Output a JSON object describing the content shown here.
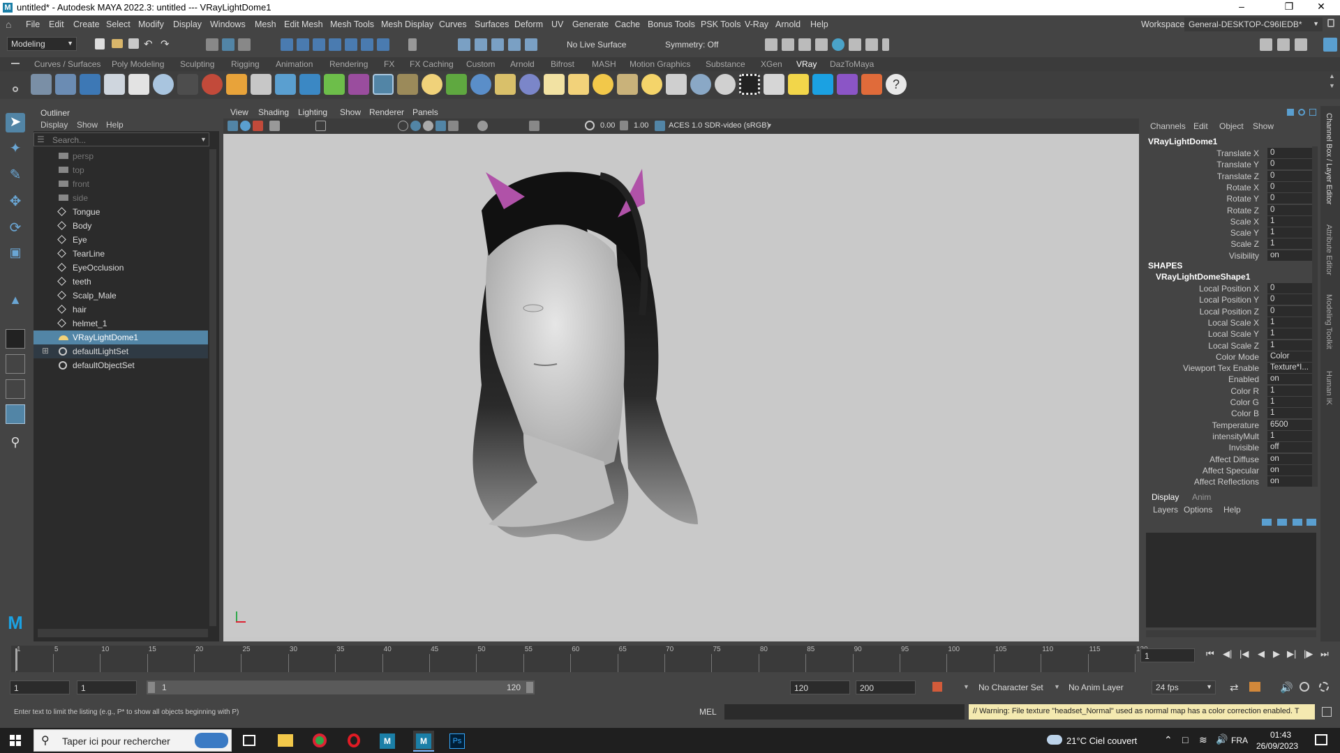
{
  "window": {
    "title": "untitled* - Autodesk MAYA 2022.3: untitled  ---  VRayLightDome1"
  },
  "menubar": {
    "items": [
      "File",
      "Edit",
      "Create",
      "Select",
      "Modify",
      "Display",
      "Windows",
      "Mesh",
      "Edit Mesh",
      "Mesh Tools",
      "Mesh Display",
      "Curves",
      "Surfaces",
      "Deform",
      "UV",
      "Generate",
      "Cache",
      "Bonus Tools",
      "PSK Tools",
      "V-Ray",
      "Arnold",
      "Help"
    ],
    "workspace_label": "Workspace:",
    "workspace_value": "General-DESKTOP-C96IEDB*"
  },
  "statusline": {
    "mode": "Modeling",
    "live_surface": "No Live Surface",
    "symmetry": "Symmetry: Off"
  },
  "shelf": {
    "tabs": [
      "Curves / Surfaces",
      "Poly Modeling",
      "Sculpting",
      "Rigging",
      "Animation",
      "Rendering",
      "FX",
      "FX Caching",
      "Custom",
      "Arnold",
      "Bifrost",
      "MASH",
      "Motion Graphics",
      "Substance",
      "XGen",
      "VRay",
      "DazToMaya"
    ],
    "active_tab": "VRay"
  },
  "outliner": {
    "title": "Outliner",
    "menu": [
      "Display",
      "Show",
      "Help"
    ],
    "search_placeholder": "Search...",
    "items": [
      {
        "label": "persp",
        "type": "camera",
        "dim": true
      },
      {
        "label": "top",
        "type": "camera",
        "dim": true
      },
      {
        "label": "front",
        "type": "camera",
        "dim": true
      },
      {
        "label": "side",
        "type": "camera",
        "dim": true
      },
      {
        "label": "Tongue",
        "type": "mesh"
      },
      {
        "label": "Body",
        "type": "mesh"
      },
      {
        "label": "Eye",
        "type": "mesh"
      },
      {
        "label": "TearLine",
        "type": "mesh"
      },
      {
        "label": "EyeOcclusion",
        "type": "mesh"
      },
      {
        "label": "teeth",
        "type": "mesh"
      },
      {
        "label": "Scalp_Male",
        "type": "mesh"
      },
      {
        "label": "hair",
        "type": "mesh"
      },
      {
        "label": "helmet_1",
        "type": "mesh"
      },
      {
        "label": "VRayLightDome1",
        "type": "light",
        "selected": true
      },
      {
        "label": "defaultLightSet",
        "type": "set",
        "expandable": true
      },
      {
        "label": "defaultObjectSet",
        "type": "set"
      }
    ]
  },
  "viewport": {
    "menu": [
      "View",
      "Shading",
      "Lighting",
      "Show",
      "Renderer",
      "Panels"
    ],
    "exposure": "0.00",
    "gamma": "1.00",
    "color_space": "ACES 1.0 SDR-video (sRGB)"
  },
  "channelbox": {
    "menu": [
      "Channels",
      "Edit",
      "Object",
      "Show"
    ],
    "object_name": "VRayLightDome1",
    "transform": [
      {
        "name": "Translate X",
        "value": "0"
      },
      {
        "name": "Translate Y",
        "value": "0"
      },
      {
        "name": "Translate Z",
        "value": "0"
      },
      {
        "name": "Rotate X",
        "value": "0"
      },
      {
        "name": "Rotate Y",
        "value": "0"
      },
      {
        "name": "Rotate Z",
        "value": "0"
      },
      {
        "name": "Scale X",
        "value": "1"
      },
      {
        "name": "Scale Y",
        "value": "1"
      },
      {
        "name": "Scale Z",
        "value": "1"
      },
      {
        "name": "Visibility",
        "value": "on"
      }
    ],
    "shapes_label": "SHAPES",
    "shape_name": "VRayLightDomeShape1",
    "shape_attrs": [
      {
        "name": "Local Position X",
        "value": "0"
      },
      {
        "name": "Local Position Y",
        "value": "0"
      },
      {
        "name": "Local Position Z",
        "value": "0"
      },
      {
        "name": "Local Scale X",
        "value": "1"
      },
      {
        "name": "Local Scale Y",
        "value": "1"
      },
      {
        "name": "Local Scale Z",
        "value": "1"
      },
      {
        "name": "Color Mode",
        "value": "Color"
      },
      {
        "name": "Viewport Tex Enable",
        "value": "Texture*I..."
      },
      {
        "name": "Enabled",
        "value": "on"
      },
      {
        "name": "Color R",
        "value": "1"
      },
      {
        "name": "Color G",
        "value": "1"
      },
      {
        "name": "Color B",
        "value": "1"
      },
      {
        "name": "Temperature",
        "value": "6500"
      },
      {
        "name": "intensityMult",
        "value": "1"
      },
      {
        "name": "Invisible",
        "value": "off"
      },
      {
        "name": "Affect Diffuse",
        "value": "on"
      },
      {
        "name": "Affect Specular",
        "value": "on"
      },
      {
        "name": "Affect Reflections",
        "value": "on"
      }
    ]
  },
  "side_tabs": [
    "Channel Box / Layer Editor",
    "Attribute Editor",
    "Modeling Toolkit",
    "Human IK"
  ],
  "layers": {
    "tabs": [
      "Display",
      "Anim"
    ],
    "menu": [
      "Layers",
      "Options",
      "Help"
    ]
  },
  "timeline": {
    "ticks": [
      "1",
      "5",
      "10",
      "15",
      "20",
      "25",
      "30",
      "35",
      "40",
      "45",
      "50",
      "55",
      "60",
      "65",
      "70",
      "75",
      "80",
      "85",
      "90",
      "95",
      "100",
      "105",
      "110",
      "115",
      "120"
    ],
    "current_frame": "1"
  },
  "range": {
    "start": "1",
    "playback_start": "1",
    "slider_start": "1",
    "slider_end": "120",
    "playback_end": "120",
    "end": "200",
    "character_set": "No Character Set",
    "anim_layer": "No Anim Layer",
    "fps": "24 fps"
  },
  "commandline": {
    "help": "Enter text to limit the listing (e.g., P* to show all objects beginning with P)",
    "mel_label": "MEL",
    "warning": "// Warning: File texture \"headset_Normal\" used as normal map has a color correction enabled. T"
  },
  "taskbar": {
    "search_placeholder": "Taper ici pour rechercher",
    "weather": "21°C  Ciel couvert",
    "language": "FRA",
    "time": "01:43",
    "date": "26/09/2023"
  },
  "colors": {
    "selection": "#5285a6",
    "ears": "#b052a8",
    "warning_bg": "#f4e9b0"
  }
}
